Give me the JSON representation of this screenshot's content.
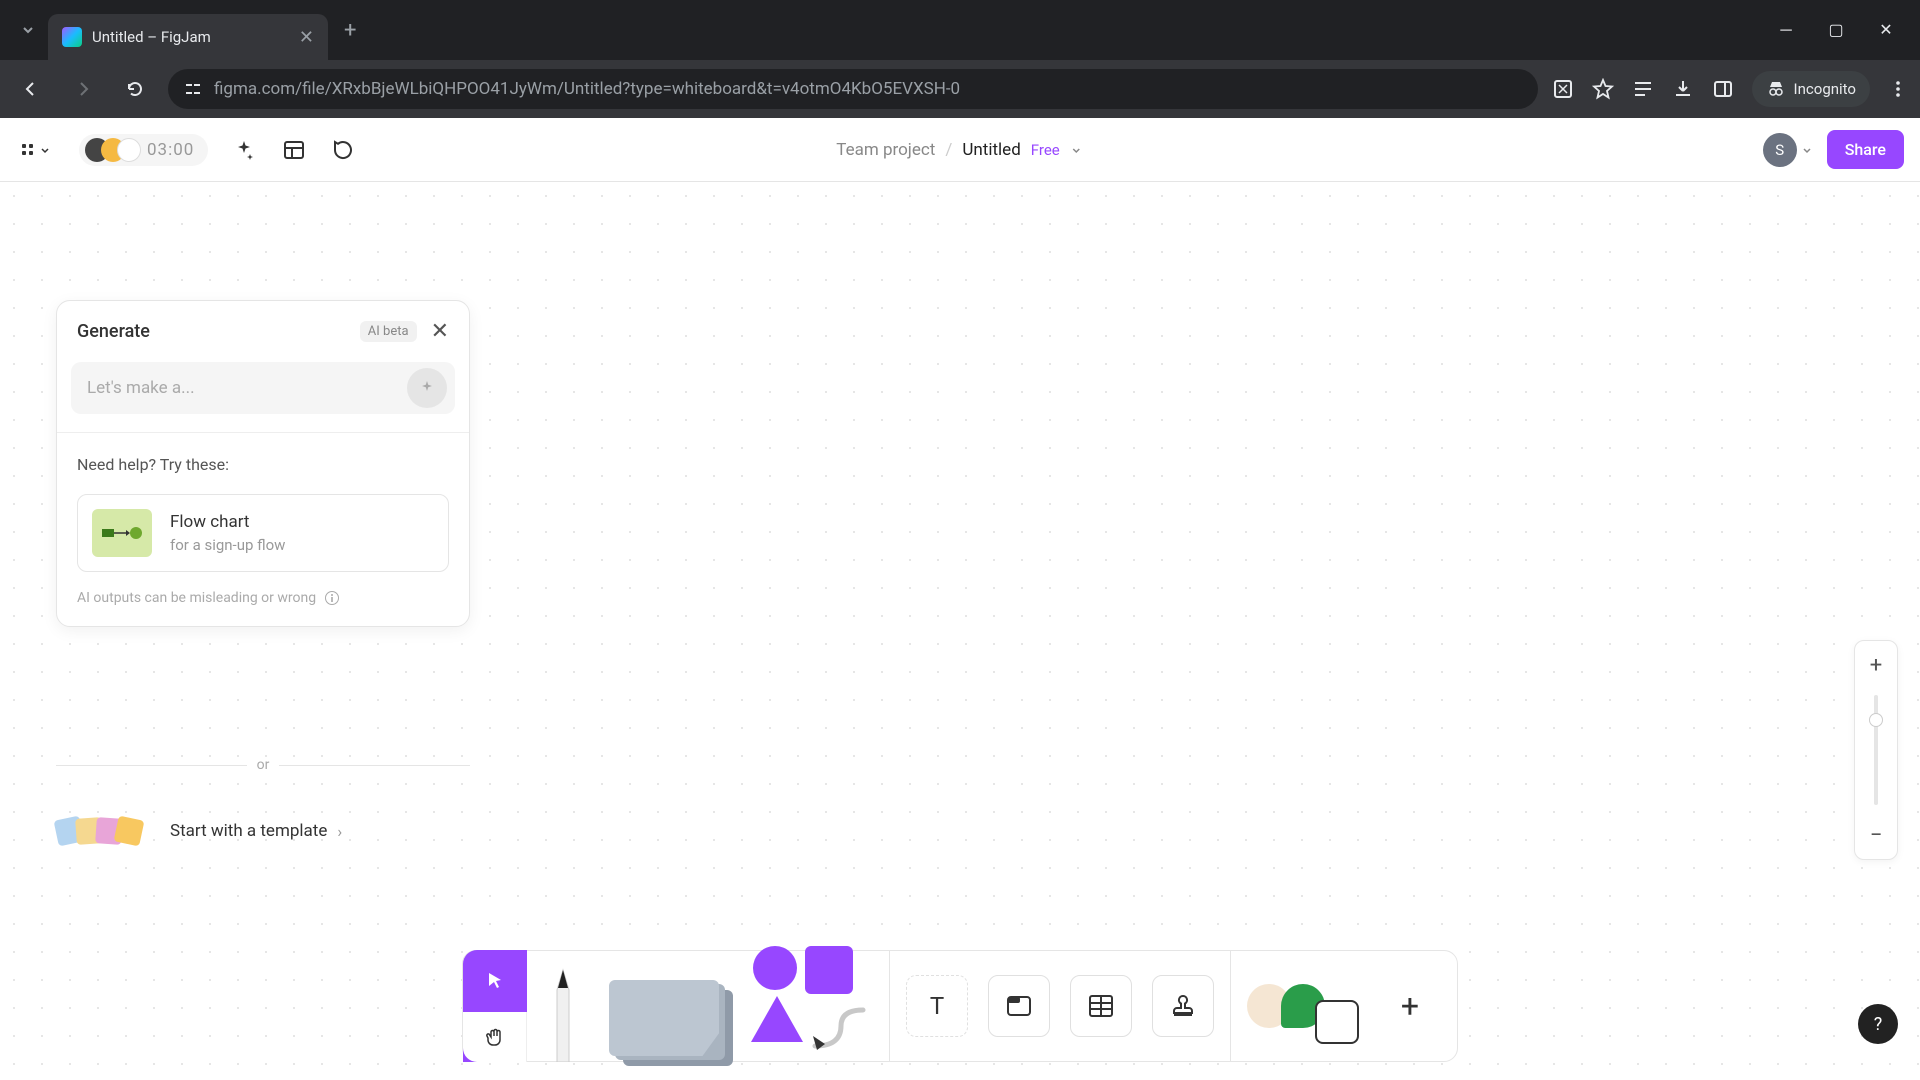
{
  "browser": {
    "tab_title": "Untitled – FigJam",
    "url": "figma.com/file/XRxbBjeWLbiQHPOO41JyWm/Untitled?type=whiteboard&t=v4otmO4KbO5EVXSH-0",
    "incognito_label": "Incognito"
  },
  "header": {
    "timer": "03:00",
    "team_label": "Team project",
    "file_name": "Untitled",
    "plan_badge": "Free",
    "avatar_initial": "S",
    "share_label": "Share"
  },
  "generate": {
    "title": "Generate",
    "ai_badge": "AI beta",
    "input_placeholder": "Let's make a...",
    "help_label": "Need help? Try these:",
    "suggestion_title": "Flow chart",
    "suggestion_subtitle": "for a sign-up flow",
    "disclaimer": "AI outputs can be misleading or wrong"
  },
  "or_label": "or",
  "template_label": "Start with a template",
  "colors": {
    "accent": "#9747ff"
  }
}
